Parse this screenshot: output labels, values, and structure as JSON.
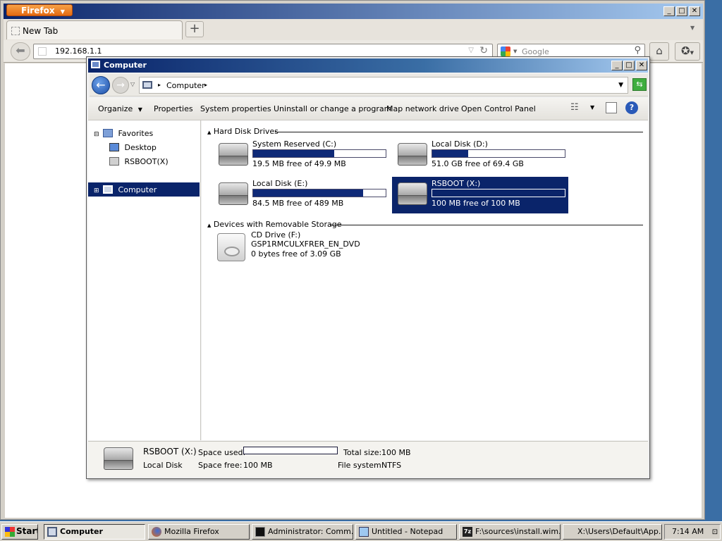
{
  "firefox": {
    "menu_button": "Firefox",
    "tab_title": "New Tab",
    "new_tab_symbol": "+",
    "url": "192.168.1.1",
    "search_placeholder": "Google"
  },
  "explorer": {
    "title": "Computer",
    "breadcrumb": "Computer",
    "commands": [
      "Organize",
      "Properties",
      "System properties",
      "Uninstall or change a program",
      "Map network drive",
      "Open Control Panel"
    ],
    "sidebar": {
      "favorites": "Favorites",
      "desktop": "Desktop",
      "rsboot": "RSBOOT(X)",
      "computer": "Computer"
    },
    "groups": {
      "hdd": "Hard Disk Drives",
      "removable": "Devices with Removable Storage"
    },
    "drives": [
      {
        "name": "System Reserved (C:)",
        "free": "19.5 MB free of 49.9 MB",
        "used_fraction": 0.61
      },
      {
        "name": "Local Disk (D:)",
        "free": "51.0 GB free of 69.4 GB",
        "used_fraction": 0.27
      },
      {
        "name": "Local Disk (E:)",
        "free": "84.5 MB free of 489 MB",
        "used_fraction": 0.83
      },
      {
        "name": "RSBOOT (X:)",
        "free": "100 MB free of 100 MB",
        "used_fraction": 0.0
      }
    ],
    "cd": {
      "name": "CD Drive (F:)",
      "label": "GSP1RMCULXFRER_EN_DVD",
      "free": "0 bytes free of 3.09 GB"
    },
    "details": {
      "name": "RSBOOT (X:)",
      "type": "Local Disk",
      "space_used_label": "Space used:",
      "space_free_label": "Space free:",
      "space_free": "100 MB",
      "total_size_label": "Total size:",
      "total_size": "100 MB",
      "filesystem_label": "File system:",
      "filesystem": "NTFS"
    }
  },
  "taskbar": {
    "start": "Start",
    "items": [
      "Computer",
      "Mozilla Firefox",
      "Administrator: Comm...",
      "Untitled - Notepad",
      "F:\\sources\\install.wim...",
      "X:\\Users\\Default\\App..."
    ],
    "clock": "7:14 AM"
  },
  "colors": {
    "selection": "#0a246a",
    "bar_fill": "#0f2a78",
    "firefox_orange": "#e46a12"
  }
}
